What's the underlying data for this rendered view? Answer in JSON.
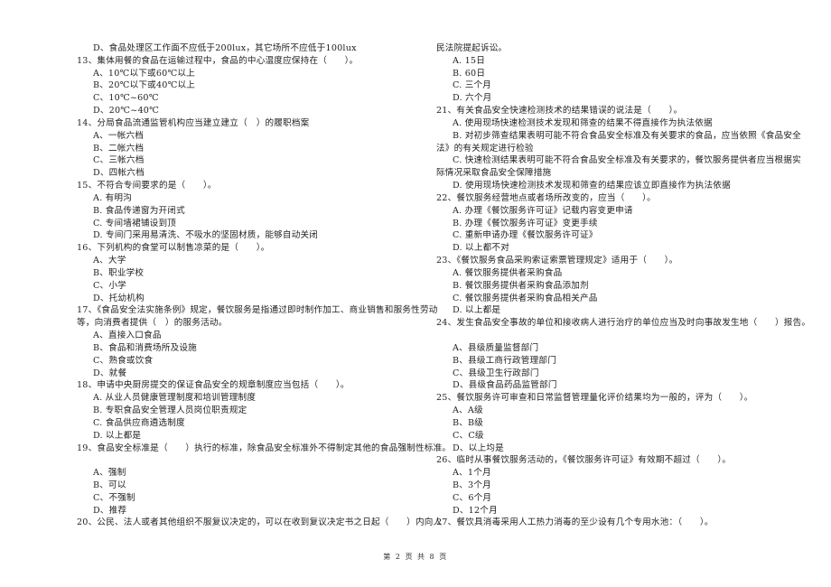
{
  "document": {
    "left_column": [
      {
        "type": "opt",
        "text": "D、食品处理区工作面不应低于200lux，其它场所不应低于100lux"
      },
      {
        "type": "q",
        "text": "13、集体用餐的食品在运输过程中，食品的中心温度应保持在（　　）。"
      },
      {
        "type": "opt",
        "text": "A、10℃以下或60℃以上"
      },
      {
        "type": "opt",
        "text": "B、20℃以下或40℃以上"
      },
      {
        "type": "opt",
        "text": "C、10℃~60℃"
      },
      {
        "type": "opt",
        "text": "D、20℃~40℃"
      },
      {
        "type": "q",
        "text": "14、分局食品流通监管机构应当建立建立（　）的履职档案"
      },
      {
        "type": "opt",
        "text": "A、一帐六档"
      },
      {
        "type": "opt",
        "text": "B、二帐六档"
      },
      {
        "type": "opt",
        "text": "C、三帐六档"
      },
      {
        "type": "opt",
        "text": "D、四帐六档"
      },
      {
        "type": "q",
        "text": "15、不符合专间要求的是（　　）。"
      },
      {
        "type": "opt",
        "text": "A. 有明沟"
      },
      {
        "type": "opt",
        "text": "B. 食品传递窗为开闭式"
      },
      {
        "type": "opt",
        "text": "C. 专间墙裙铺设到顶"
      },
      {
        "type": "opt",
        "text": "D. 专间门采用易清洗、不吸水的坚固材质，能够自动关闭"
      },
      {
        "type": "q",
        "text": "16、下列机构的食堂可以制售凉菜的是（　　）。"
      },
      {
        "type": "opt",
        "text": "A、大学"
      },
      {
        "type": "opt",
        "text": "B、职业学校"
      },
      {
        "type": "opt",
        "text": "C、小学"
      },
      {
        "type": "opt",
        "text": "D、托幼机构"
      },
      {
        "type": "q",
        "text": "17、《食品安全法实施条例》规定，餐饮服务是指通过即时制作加工、商业销售和服务性劳动"
      },
      {
        "type": "cont",
        "text": "等，向消费者提供（　）的服务活动。"
      },
      {
        "type": "opt",
        "text": "A、直接入口食品"
      },
      {
        "type": "opt",
        "text": "B、食品和消费场所及设施"
      },
      {
        "type": "opt",
        "text": "C、熟食或饮食"
      },
      {
        "type": "opt",
        "text": "D、就餐"
      },
      {
        "type": "q",
        "text": "18、申请中央厨房提交的保证食品安全的规章制度应当包括（　　）。"
      },
      {
        "type": "opt",
        "text": "A. 从业人员健康管理制度和培训管理制度"
      },
      {
        "type": "opt",
        "text": "B. 专职食品安全管理人员岗位职责规定"
      },
      {
        "type": "opt",
        "text": "C. 食品供应商遴选制度"
      },
      {
        "type": "opt",
        "text": "D. 以上都是"
      },
      {
        "type": "q",
        "text": "19、食品安全标准是（　　）执行的标准，除食品安全标准外不得制定其他的食品强制性标准。"
      },
      {
        "type": "blank",
        "text": ""
      },
      {
        "type": "opt",
        "text": "A、强制"
      },
      {
        "type": "opt",
        "text": "B、可以"
      },
      {
        "type": "opt",
        "text": "C、不强制"
      },
      {
        "type": "opt",
        "text": "D、推荐"
      },
      {
        "type": "q",
        "text": "20、公民、法人或者其他组织不服复议决定的，可以在收到复议决定书之日起（　　）内向人"
      }
    ],
    "right_column": [
      {
        "type": "cont",
        "text": "民法院提起诉讼。"
      },
      {
        "type": "opt",
        "text": "A. 15日"
      },
      {
        "type": "opt",
        "text": "B. 60日"
      },
      {
        "type": "opt",
        "text": "C. 三个月"
      },
      {
        "type": "opt",
        "text": "D. 六个月"
      },
      {
        "type": "q",
        "text": "21、有关食品安全快速检测技术的结果错误的说法是（　　）。"
      },
      {
        "type": "opt",
        "text": "A. 使用现场快速检测技术发现和筛查的结果不得直接作为执法依据"
      },
      {
        "type": "opt",
        "text": "B. 对初步筛查结果表明可能不符合食品安全标准及有关要求的食品，应当依照《食品安全"
      },
      {
        "type": "cont",
        "text": "法》的有关规定进行检验"
      },
      {
        "type": "opt",
        "text": "C. 快速检测结果表明可能不符合食品安全标准及有关要求的，餐饮服务提供者应当根据实"
      },
      {
        "type": "cont",
        "text": "际情况采取食品安全保障措施"
      },
      {
        "type": "opt",
        "text": "D. 使用现场快速检测技术发现和筛查的结果应该立即直接作为执法依据"
      },
      {
        "type": "q",
        "text": "22、餐饮服务经营地点或者场所改变的，应当（　　）。"
      },
      {
        "type": "opt",
        "text": "A. 办理《餐饮服务许可证》记载内容变更申请"
      },
      {
        "type": "opt",
        "text": "B. 办理《餐饮服务许可证》变更手续"
      },
      {
        "type": "opt",
        "text": "C. 重新申请办理《餐饮服务许可证》"
      },
      {
        "type": "opt",
        "text": "D. 以上都不对"
      },
      {
        "type": "q",
        "text": "23、《餐饮服务食品采购索证索票管理规定》适用于（　　）。"
      },
      {
        "type": "opt",
        "text": "A. 餐饮服务提供者采购食品"
      },
      {
        "type": "opt",
        "text": "B. 餐饮服务提供者采购食品添加剂"
      },
      {
        "type": "opt",
        "text": "C. 餐饮服务提供者采购食品相关产品"
      },
      {
        "type": "opt",
        "text": "D. 以上都是"
      },
      {
        "type": "q",
        "text": "24、发生食品安全事故的单位和接收病人进行治疗的单位应当及时向事故发生地（　　）报告。"
      },
      {
        "type": "blank",
        "text": ""
      },
      {
        "type": "opt",
        "text": "A、县级质量监督部门"
      },
      {
        "type": "opt",
        "text": "B、县级工商行政管理部门"
      },
      {
        "type": "opt",
        "text": "C、县级卫生行政部门"
      },
      {
        "type": "opt",
        "text": "D、县级食品药品监管部门"
      },
      {
        "type": "q",
        "text": "25、餐饮服务许可审查和日常监督管理量化评价结果均为一般的，评为（　　）。"
      },
      {
        "type": "opt",
        "text": "A、A级"
      },
      {
        "type": "opt",
        "text": "B、B级"
      },
      {
        "type": "opt",
        "text": "C、C级"
      },
      {
        "type": "opt",
        "text": "D、以上均是"
      },
      {
        "type": "q",
        "text": "26、临时从事餐饮服务活动的，《餐饮服务许可证》有效期不超过（　　）。"
      },
      {
        "type": "opt",
        "text": "A、1个月"
      },
      {
        "type": "opt",
        "text": "B、3个月"
      },
      {
        "type": "opt",
        "text": "C、6个月"
      },
      {
        "type": "opt",
        "text": "D、12个月"
      },
      {
        "type": "q",
        "text": "27、餐饮具消毒采用人工热力消毒的至少设有几个专用水池：（　　）。"
      }
    ],
    "footer": {
      "page_label": "第 2 页 共 8 页"
    }
  }
}
